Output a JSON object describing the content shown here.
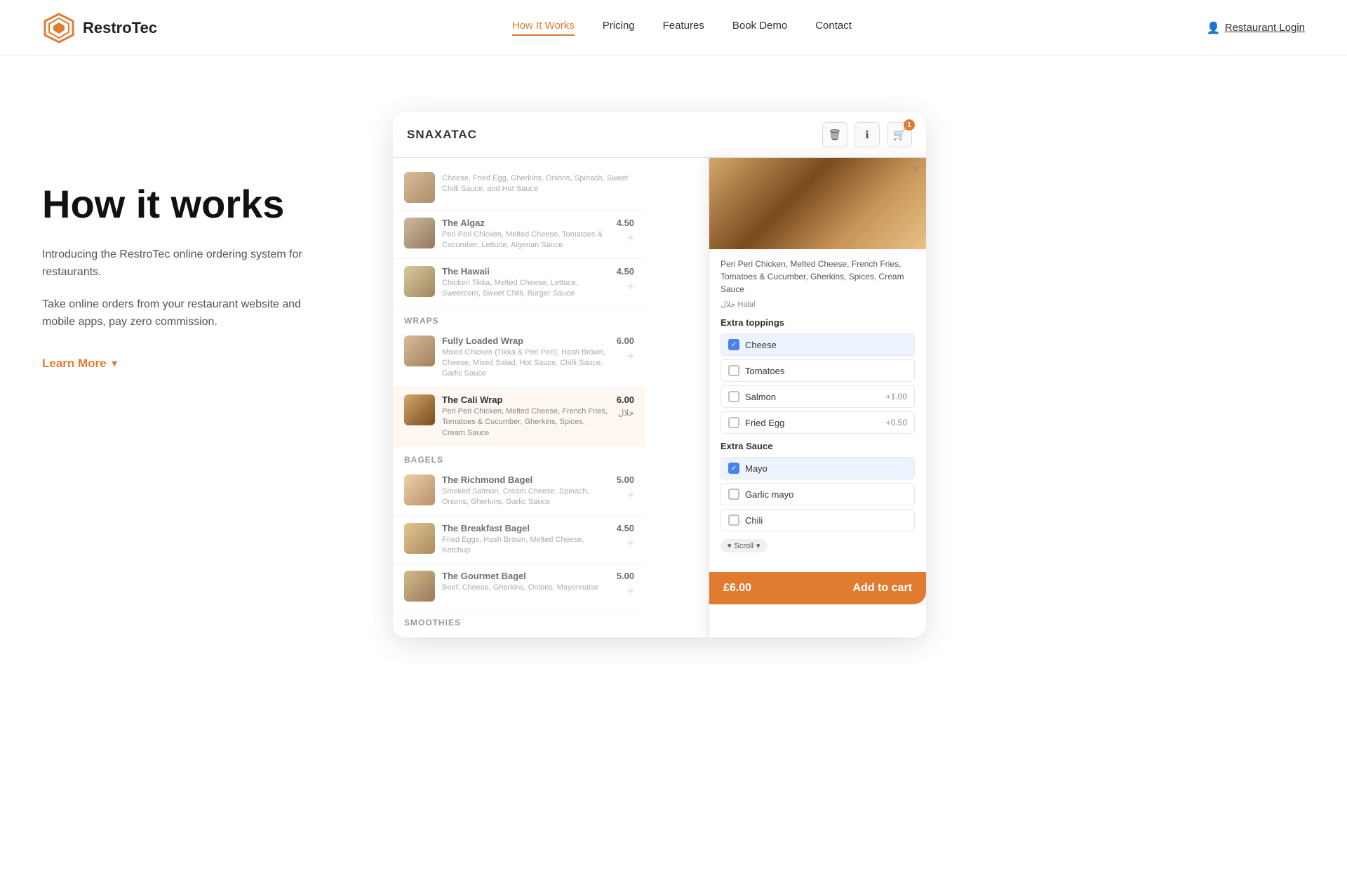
{
  "brand": {
    "name": "RestroTec",
    "logo_alt": "RestroTec logo"
  },
  "nav": {
    "links": [
      {
        "label": "How It Works",
        "active": true
      },
      {
        "label": "Pricing",
        "active": false
      },
      {
        "label": "Features",
        "active": false
      },
      {
        "label": "Book Demo",
        "active": false
      },
      {
        "label": "Contact",
        "active": false
      }
    ],
    "login_label": "Restaurant Login"
  },
  "hero": {
    "title": "How it works",
    "desc1": "Introducing the RestroTec online ordering system for restaurants.",
    "desc2": "Take online orders from your restaurant website and mobile apps, pay zero commission.",
    "learn_more": "Learn More"
  },
  "mockup": {
    "brand_name": "SNAXATAC",
    "cart_count": "1",
    "menu_sections": [
      {
        "type": "item",
        "name": "",
        "desc": "Cheese, Fried Egg, Gherkins, Onions, Spinach, Sweet Chilli Sauce, and Hot Sauce",
        "price": ""
      },
      {
        "type": "item",
        "name": "The Algaz",
        "desc": "Peri Peri Chicken, Melted Cheese, Tomatoes & Cucumber, Lettuce, Algerian Sauce",
        "price": "4.50"
      },
      {
        "type": "item",
        "name": "The Hawaii",
        "desc": "Chicken Tikka, Melted Cheese, Lettuce, Sweetcorn, Sweet Chilli, Burger Sauce",
        "price": "4.50"
      },
      {
        "type": "section",
        "label": "WRAPS"
      },
      {
        "type": "item",
        "name": "Fully Loaded Wrap",
        "desc": "Mixed Chicken (Tikka & Peri Peri), Hash Brown, Cheese, Mixed Salad, Hot Sauce, Chilli Sauce, Garlic Sauce",
        "price": "6.00"
      },
      {
        "type": "item",
        "name": "The Cali Wrap",
        "desc": "Peri Peri Chicken, Melted Cheese, French Fries, Tomatoes & Cucumber, Gherkins, Spices, Cream Sauce",
        "price": "6.00",
        "selected": true,
        "halal": "حلال"
      },
      {
        "type": "section",
        "label": "BAGELS"
      },
      {
        "type": "item",
        "name": "The Richmond Bagel",
        "desc": "Smoked Salmon, Cream Cheese, Spinach, Onions, Gherkins, Garlic Sauce",
        "price": "5.00"
      },
      {
        "type": "item",
        "name": "The Breakfast Bagel",
        "desc": "Fried Eggs, Hash Brown, Melted Cheese, Ketchup",
        "price": "4.50"
      },
      {
        "type": "item",
        "name": "The Gourmet Bagel",
        "desc": "Beef, Cheese, Gherkins, Onions, Mayonnaise",
        "price": "5.00"
      },
      {
        "type": "section",
        "label": "SMOOTHIES"
      }
    ],
    "detail_panel": {
      "desc": "Peri Peri Chicken, Melted Cheese, French Fries, Tomatoes & Cucumber, Gherkins, Spices, Cream Sauce",
      "halal": "حلال  Halal",
      "extra_toppings_title": "Extra toppings",
      "toppings": [
        {
          "label": "Cheese",
          "checked": true,
          "price": ""
        },
        {
          "label": "Tomatoes",
          "checked": false,
          "price": ""
        },
        {
          "label": "Salmon",
          "checked": false,
          "price": "+1.00"
        },
        {
          "label": "Fried Egg",
          "checked": false,
          "price": "+0.50"
        }
      ],
      "extra_sauce_title": "Extra Sauce",
      "sauces": [
        {
          "label": "Mayo",
          "checked": true,
          "price": ""
        },
        {
          "label": "Garlic mayo",
          "checked": false,
          "price": ""
        },
        {
          "label": "Chili",
          "checked": false,
          "price": ""
        }
      ],
      "scroll_label": "Scroll",
      "add_price": "£6.00",
      "add_label": "Add to cart"
    }
  },
  "icons": {
    "trash": "🗑",
    "info": "ℹ",
    "cart": "🛒",
    "user": "👤",
    "check": "✓",
    "close": "×",
    "chevron_down": "▾"
  }
}
